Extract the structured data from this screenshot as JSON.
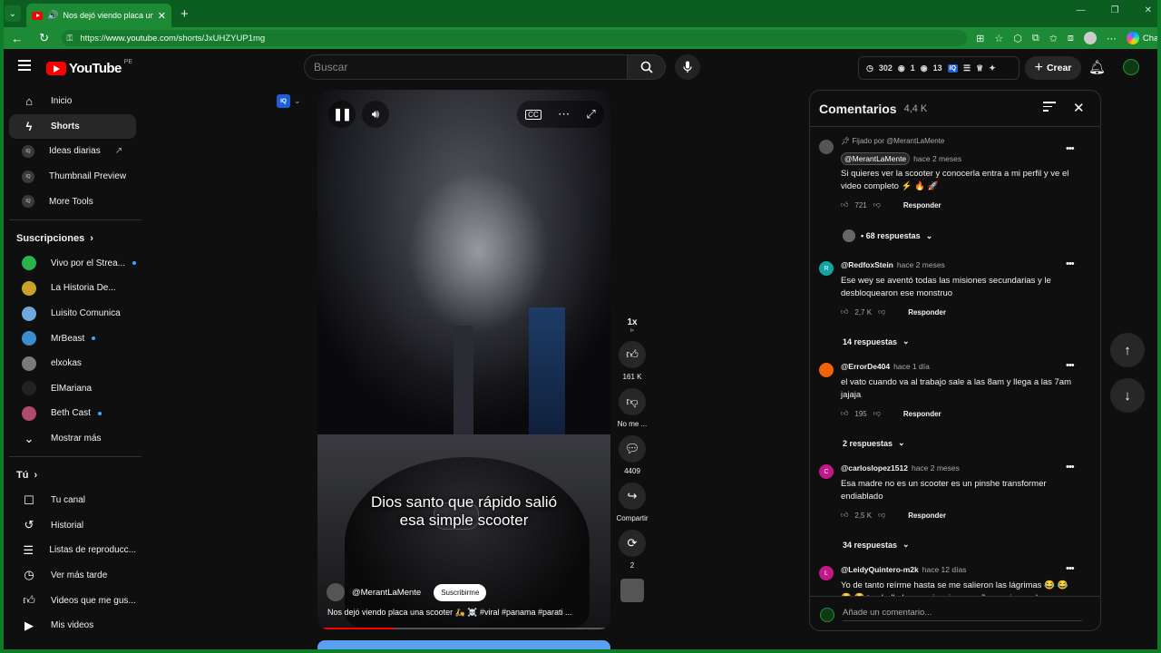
{
  "browser": {
    "tab_title": "Nos dejó viendo placa una sc",
    "url_prefix": "https://",
    "url_host": "www.youtube.com",
    "url_path": "/shorts/JxUHZYUP1mg",
    "chat_label": "Chat"
  },
  "masthead": {
    "logo_text": "YouTube",
    "country_code": "PE",
    "search_placeholder": "Buscar",
    "stats": [
      "302",
      "1",
      "13"
    ],
    "iq_badge": "IQ",
    "create_label": "Crear"
  },
  "sidebar": {
    "main": [
      {
        "label": "Inicio",
        "icon": "home-icon"
      },
      {
        "label": "Shorts",
        "icon": "shorts-icon",
        "active": true
      },
      {
        "label": "Ideas diarias",
        "icon": "iq-icon"
      },
      {
        "label": "Thumbnail Preview",
        "icon": "iq-icon"
      },
      {
        "label": "More Tools",
        "icon": "iq-icon"
      }
    ],
    "subs_heading": "Suscripciones",
    "subs": [
      {
        "label": "Vivo por el Strea...",
        "color": "#2bb24c",
        "dot": true
      },
      {
        "label": "La Historia De...",
        "color": "#c9a227",
        "dot": false
      },
      {
        "label": "Luisito Comunica",
        "color": "#6fa8dc",
        "dot": false
      },
      {
        "label": "MrBeast",
        "color": "#3b8fd0",
        "dot": true
      },
      {
        "label": "elxokas",
        "color": "#7a7a7a",
        "dot": false
      },
      {
        "label": "ElMariana",
        "color": "#222222",
        "dot": false
      },
      {
        "label": "Beth Cast",
        "color": "#b04b6a",
        "dot": true
      }
    ],
    "show_more": "Mostrar más",
    "you_heading": "Tú",
    "you": [
      {
        "label": "Tu canal",
        "icon": "channel-icon"
      },
      {
        "label": "Historial",
        "icon": "history-icon"
      },
      {
        "label": "Listas de reproducc...",
        "icon": "playlists-icon"
      },
      {
        "label": "Ver más tarde",
        "icon": "watch-later-icon"
      },
      {
        "label": "Videos que me gus...",
        "icon": "liked-icon"
      },
      {
        "label": "Mis videos",
        "icon": "my-videos-icon"
      }
    ]
  },
  "video": {
    "iq_chip": "IQ",
    "caption_line1": "Dios santo que rápido salió",
    "caption_line2": "esa simple scooter",
    "channel": "@MerantLaMente",
    "subscribe": "Suscribirme",
    "title": "Nos dejó viendo placa una scooter 🛵 ☠️ #viral #panama #parati ...",
    "progress": 0.25
  },
  "actions": {
    "speed": "1x",
    "likes": "161 K",
    "dislike": "No me ...",
    "comments": "4409",
    "share": "Compartir",
    "remix": "2"
  },
  "comments_panel": {
    "title": "Comentarios",
    "count": "4,4 K",
    "pinned_by": "Fijado por @MerantLaMente",
    "reply_label": "Responder",
    "add_placeholder": "Añade un comentario...",
    "items": [
      {
        "author": "@MerantLaMente",
        "time": "hace 2 meses",
        "text": "Si quieres ver la scooter y conocerla entra a mi perfil y ve el video completo ⚡ 🔥 🚀",
        "likes": "721",
        "replies": "• 68 respuestas",
        "avatar_letter": "",
        "avatar_color": "#555555"
      },
      {
        "author": "@RedfoxStein",
        "time": "hace 2 meses",
        "text": "Ese wey se aventó todas las misiones secundarias y le desbloquearon ese monstruo",
        "likes": "2,7 K",
        "replies": "14 respuestas",
        "avatar_letter": "R",
        "avatar_color": "#12a4a0"
      },
      {
        "author": "@ErrorDe404",
        "time": "hace 1 día",
        "text": "el vato cuando va al trabajo sale a las 8am y llega a las 7am jajaja",
        "likes": "195",
        "replies": "2 respuestas",
        "avatar_letter": "",
        "avatar_color": "#f0620a"
      },
      {
        "author": "@carloslopez1512",
        "time": "hace 2 meses",
        "text": "Esa madre no es un scooter es un pinshe transformer endiablado",
        "likes": "2,5 K",
        "replies": "34 respuestas",
        "avatar_letter": "C",
        "avatar_color": "#c2188a"
      },
      {
        "author": "@LeidyQuintero-m2k",
        "time": "hace 12 días",
        "text": "Yo de tanto reírme hasta se me salieron las lágrimas 😂 😂 😂 😂 tan bello las apariencias engañan amigo no hay q",
        "likes": "",
        "replies": "",
        "avatar_letter": "L",
        "avatar_color": "#c2188a"
      }
    ]
  }
}
